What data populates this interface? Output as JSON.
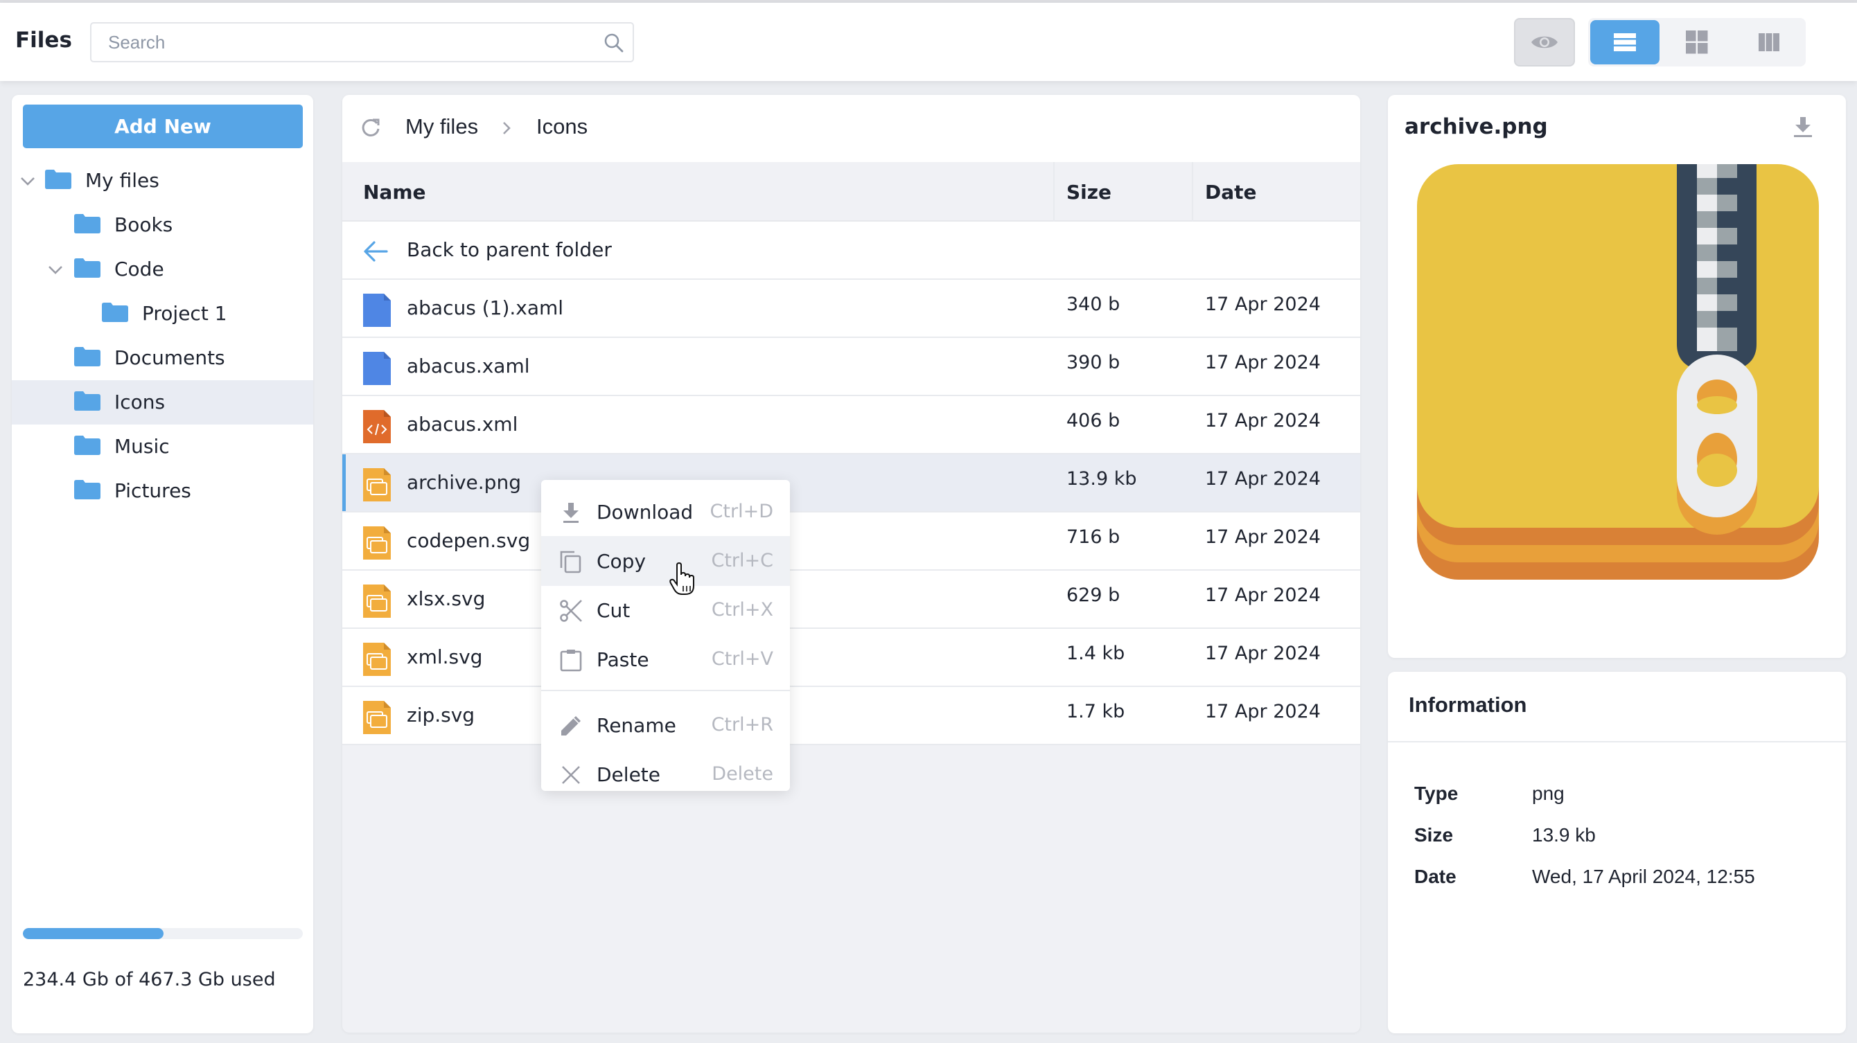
{
  "header": {
    "title": "Files",
    "search_placeholder": "Search",
    "search_value": "",
    "icons": {
      "search": "search-icon",
      "preview": "eye-icon"
    },
    "view_modes": [
      {
        "name": "list",
        "icon": "list-icon",
        "active": true
      },
      {
        "name": "grid",
        "icon": "grid-icon",
        "active": false
      },
      {
        "name": "columns",
        "icon": "columns-icon",
        "active": false
      }
    ]
  },
  "sidebar": {
    "add_new_label": "Add New",
    "tree": [
      {
        "label": "My files",
        "level": 0,
        "expandable": true,
        "expanded": true,
        "selected": false
      },
      {
        "label": "Books",
        "level": 1,
        "expandable": false,
        "selected": false
      },
      {
        "label": "Code",
        "level": 1,
        "expandable": true,
        "expanded": true,
        "selected": false
      },
      {
        "label": "Project 1",
        "level": 2,
        "expandable": false,
        "selected": false
      },
      {
        "label": "Documents",
        "level": 1,
        "expandable": false,
        "selected": false
      },
      {
        "label": "Icons",
        "level": 1,
        "expandable": false,
        "selected": true
      },
      {
        "label": "Music",
        "level": 1,
        "expandable": false,
        "selected": false
      },
      {
        "label": "Pictures",
        "level": 1,
        "expandable": false,
        "selected": false
      }
    ],
    "storage": {
      "used_fraction": 0.5016,
      "text": "234.4 Gb of 467.3 Gb used"
    }
  },
  "main": {
    "breadcrumb": [
      "My files",
      "Icons"
    ],
    "columns": [
      "Name",
      "Size",
      "Date"
    ],
    "back_label": "Back to parent folder",
    "files": [
      {
        "name": "abacus (1).xaml",
        "size": "340 b",
        "date": "17 Apr 2024",
        "icon": "document-icon",
        "selected": false
      },
      {
        "name": "abacus.xaml",
        "size": "390 b",
        "date": "17 Apr 2024",
        "icon": "document-icon",
        "selected": false
      },
      {
        "name": "abacus.xml",
        "size": "406 b",
        "date": "17 Apr 2024",
        "icon": "code-file-icon",
        "selected": false
      },
      {
        "name": "archive.png",
        "size": "13.9 kb",
        "date": "17 Apr 2024",
        "icon": "image-file-icon",
        "selected": true
      },
      {
        "name": "codepen.svg",
        "size": "716 b",
        "date": "17 Apr 2024",
        "icon": "image-file-icon",
        "selected": false
      },
      {
        "name": "xlsx.svg",
        "size": "629 b",
        "date": "17 Apr 2024",
        "icon": "image-file-icon",
        "selected": false
      },
      {
        "name": "xml.svg",
        "size": "1.4 kb",
        "date": "17 Apr 2024",
        "icon": "image-file-icon",
        "selected": false
      },
      {
        "name": "zip.svg",
        "size": "1.7 kb",
        "date": "17 Apr 2024",
        "icon": "image-file-icon",
        "selected": false
      }
    ]
  },
  "context_menu": {
    "items": [
      {
        "label": "Download",
        "shortcut": "Ctrl+D",
        "icon": "download-icon"
      },
      {
        "label": "Copy",
        "shortcut": "Ctrl+C",
        "icon": "copy-icon",
        "hover": true
      },
      {
        "label": "Cut",
        "shortcut": "Ctrl+X",
        "icon": "scissors-icon"
      },
      {
        "label": "Paste",
        "shortcut": "Ctrl+V",
        "icon": "clipboard-icon"
      },
      {
        "label": "Rename",
        "shortcut": "Ctrl+R",
        "icon": "pencil-icon"
      },
      {
        "label": "Delete",
        "shortcut": "Delete",
        "icon": "close-icon"
      }
    ]
  },
  "preview": {
    "title": "archive.png",
    "image": "zip-archive-image"
  },
  "info": {
    "title": "Information",
    "rows": [
      {
        "key": "Type",
        "value": "png"
      },
      {
        "key": "Size",
        "value": "13.9 kb"
      },
      {
        "key": "Date",
        "value": "Wed, 17 April 2024, 12:55"
      }
    ]
  },
  "colors": {
    "accent": "#57a5e6",
    "folder": "#57a5e6",
    "doc_blue": "#4f86e4",
    "code_orange": "#e06b2b",
    "image_yellow": "#f2ad3d",
    "selected_bg": "#e9ecf3"
  }
}
